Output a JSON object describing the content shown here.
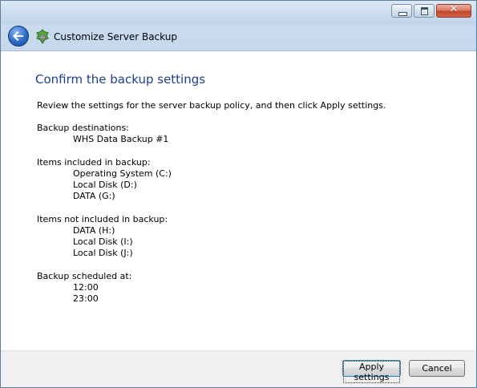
{
  "window": {
    "title": "Customize Server Backup",
    "caption_buttons": [
      "minimize-icon",
      "maximize-icon",
      "close-icon"
    ]
  },
  "header": {
    "back_icon": "back-arrow-icon",
    "app_icon": "server-backup-icon",
    "title": "Customize Server Backup"
  },
  "main": {
    "page_title": "Confirm the backup settings",
    "instructions": "Review the settings for the server backup policy, and then click Apply settings.",
    "sections": [
      {
        "heading": "Backup destinations:",
        "items": [
          "WHS Data Backup #1"
        ]
      },
      {
        "heading": "Items included in backup:",
        "items": [
          "Operating System (C:)",
          "Local Disk (D:)",
          "DATA (G:)"
        ]
      },
      {
        "heading": "Items not included in backup:",
        "items": [
          "DATA (H:)",
          "Local Disk (I:)",
          "Local Disk (J:)"
        ]
      },
      {
        "heading": "Backup scheduled at:",
        "items": [
          "12:00",
          "23:00"
        ]
      }
    ]
  },
  "footer": {
    "apply_label": "Apply settings",
    "cancel_label": "Cancel"
  },
  "colors": {
    "title_text": "#1e3f8c",
    "chrome": "#c6d8ec",
    "footer_bg": "#f0f0f0"
  }
}
